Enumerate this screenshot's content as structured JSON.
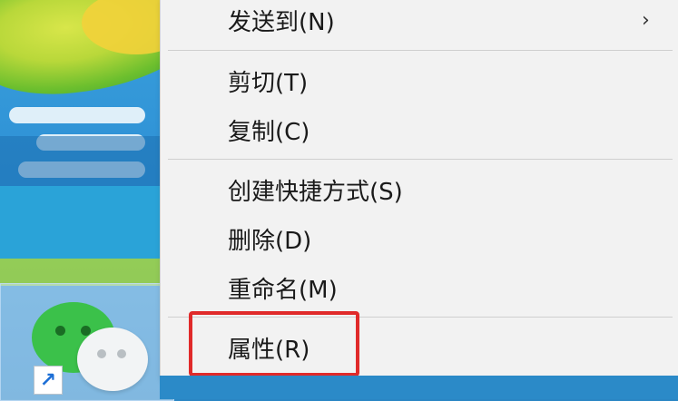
{
  "context_menu": {
    "items": [
      {
        "label": "发送到(N)",
        "has_submenu": true,
        "submenu_arrow": "›"
      },
      {
        "label": "剪切(T)"
      },
      {
        "label": "复制(C)"
      },
      {
        "label": "创建快捷方式(S)"
      },
      {
        "label": "删除(D)"
      },
      {
        "label": "重命名(M)"
      },
      {
        "label": "属性(R)",
        "highlighted": true
      }
    ]
  },
  "desktop": {
    "icon_name": "wechat-icon",
    "shortcut_arrow": "↗"
  },
  "colors": {
    "menu_background": "#f2f2f2",
    "highlight_border": "#e02a2a",
    "wechat_green": "#3bc14a"
  }
}
